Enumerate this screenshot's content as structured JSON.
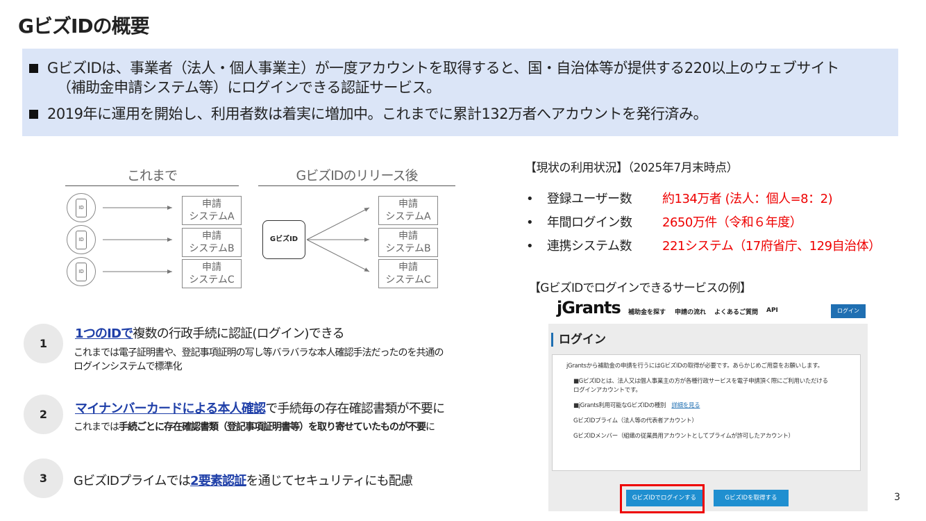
{
  "page": {
    "title": "GビズIDの概要",
    "page_number": "3"
  },
  "summary": [
    {
      "line1": "GビズIDは、事業者（法人・個人事業主）が一度アカウントを取得すると、国・自治体等が提供する220以上のウェブサイト",
      "line2": "（補助金申請システム等）にログインできる認証サービス。"
    },
    {
      "line1": "2019年に運用を開始し、利用者数は着実に増加中。これまでに累計132万者へアカウントを発行済み。",
      "line2": ""
    }
  ],
  "diagram": {
    "before_header": "これまで",
    "after_header": "GビズIDのリリース後",
    "id_label": "ID",
    "gbiz_label": "GビズID",
    "systems": [
      {
        "line1": "申請",
        "line2": "システムA"
      },
      {
        "line1": "申請",
        "line2": "システムB"
      },
      {
        "line1": "申請",
        "line2": "システムC"
      }
    ]
  },
  "features": [
    {
      "num": "1",
      "headline_hl": "1つのIDで",
      "headline_rest": "複数の行政手続に認証(ログイン)できる",
      "desc_line1": "これまでは電子証明書や、登記事項証明の写し等バラバラな本人確認手法だったのを共通の",
      "desc_line2": "ログインシステムで標準化"
    },
    {
      "num": "2",
      "headline_hl": "マイナンバーカードによる本人確認",
      "headline_rest": "で手続毎の存在確認書類が不要に",
      "desc_pre": "これまでは",
      "desc_bold": "手続ごとに存在確認書類（登記事項証明書等）を取り寄せていたものが不要",
      "desc_post": "に"
    },
    {
      "num": "3",
      "headline_pre": "GビズIDプライムでは",
      "headline_hl": "2要素認証",
      "headline_rest": "を通じてセキュリティにも配慮"
    }
  ],
  "status": {
    "title": "【現状の利用状況】（2025年7月末時点）",
    "bullet": "•",
    "items": [
      {
        "label": "登録ユーザー数",
        "value": "約134万者 (法人：個人=8：2)"
      },
      {
        "label": "年間ログイン数",
        "value": "2650万件（令和６年度）"
      },
      {
        "label": "連携システム数",
        "value": "221システム（17府省庁、129自治体）"
      }
    ],
    "colors": {
      "value": "#ee0000"
    }
  },
  "example": {
    "title": "【GビズIDでログインできるサービスの例】",
    "logo": "jGrants",
    "nav": [
      "補助金を探す",
      "申請の流れ",
      "よくあるご質問",
      "API"
    ],
    "login_button": "ログイン",
    "heading": "ログイン",
    "card": {
      "p1": "jGrantsから補助金の申請を行うにはGビズIDの取得が必要です。あらかじめご用意をお願いします。",
      "p2a": "■GビズIDとは、法人又は個人事業主の方が各種行政サービスを電子申請頂く際にご利用いただける",
      "p2b": "ログインアカウントです。",
      "p3": "■jGrants利用可能なGビズIDの種別",
      "p3_link": "詳細を見る",
      "p4": "GビズIDプライム（法人等の代表者アカウント）",
      "p5": "GビズIDメンバー（組織の従業員用アカウントとしてプライムが許可したアカウント）"
    },
    "btn_login": "GビズIDでログインする",
    "btn_get": "GビズIDを取得する",
    "accent": "#1f6fb2"
  }
}
